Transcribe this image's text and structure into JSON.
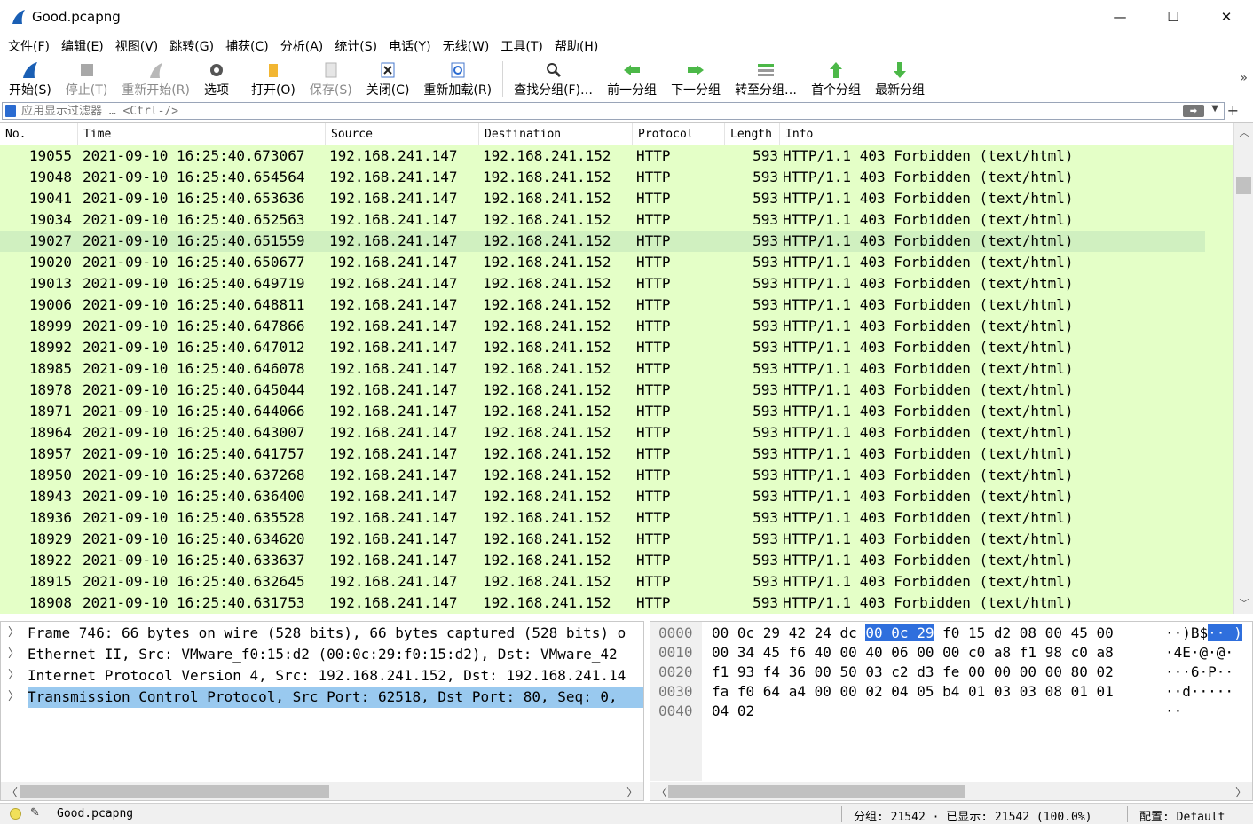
{
  "window": {
    "title": "Good.pcapng",
    "minimize_glyph": "—",
    "maximize_glyph": "☐",
    "close_glyph": "✕"
  },
  "menu": [
    "文件(F)",
    "编辑(E)",
    "视图(V)",
    "跳转(G)",
    "捕获(C)",
    "分析(A)",
    "统计(S)",
    "电话(Y)",
    "无线(W)",
    "工具(T)",
    "帮助(H)"
  ],
  "toolbar": {
    "start": "开始(S)",
    "stop": "停止(T)",
    "restart": "重新开始(R)",
    "options": "选项",
    "open": "打开(O)",
    "save": "保存(S)",
    "close": "关闭(C)",
    "reload": "重新加载(R)",
    "find": "查找分组(F)…",
    "prev": "前一分组",
    "next": "下一分组",
    "goto": "转至分组…",
    "first": "首个分组",
    "last": "最新分组",
    "more": "»"
  },
  "filter": {
    "placeholder": "应用显示过滤器 … <Ctrl-/>",
    "add": "+"
  },
  "packet_list": {
    "columns": [
      "No.",
      "Time",
      "Source",
      "Destination",
      "Protocol",
      "Length",
      "Info"
    ],
    "selected_row": 4,
    "rows": [
      {
        "no": "19055",
        "time": "2021-09-10 16:25:40.673067",
        "src": "192.168.241.147",
        "dst": "192.168.241.152",
        "proto": "HTTP",
        "len": "593",
        "info": "HTTP/1.1 403 Forbidden  (text/html)"
      },
      {
        "no": "19048",
        "time": "2021-09-10 16:25:40.654564",
        "src": "192.168.241.147",
        "dst": "192.168.241.152",
        "proto": "HTTP",
        "len": "593",
        "info": "HTTP/1.1 403 Forbidden  (text/html)"
      },
      {
        "no": "19041",
        "time": "2021-09-10 16:25:40.653636",
        "src": "192.168.241.147",
        "dst": "192.168.241.152",
        "proto": "HTTP",
        "len": "593",
        "info": "HTTP/1.1 403 Forbidden  (text/html)"
      },
      {
        "no": "19034",
        "time": "2021-09-10 16:25:40.652563",
        "src": "192.168.241.147",
        "dst": "192.168.241.152",
        "proto": "HTTP",
        "len": "593",
        "info": "HTTP/1.1 403 Forbidden  (text/html)"
      },
      {
        "no": "19027",
        "time": "2021-09-10 16:25:40.651559",
        "src": "192.168.241.147",
        "dst": "192.168.241.152",
        "proto": "HTTP",
        "len": "593",
        "info": "HTTP/1.1 403 Forbidden  (text/html)"
      },
      {
        "no": "19020",
        "time": "2021-09-10 16:25:40.650677",
        "src": "192.168.241.147",
        "dst": "192.168.241.152",
        "proto": "HTTP",
        "len": "593",
        "info": "HTTP/1.1 403 Forbidden  (text/html)"
      },
      {
        "no": "19013",
        "time": "2021-09-10 16:25:40.649719",
        "src": "192.168.241.147",
        "dst": "192.168.241.152",
        "proto": "HTTP",
        "len": "593",
        "info": "HTTP/1.1 403 Forbidden  (text/html)"
      },
      {
        "no": "19006",
        "time": "2021-09-10 16:25:40.648811",
        "src": "192.168.241.147",
        "dst": "192.168.241.152",
        "proto": "HTTP",
        "len": "593",
        "info": "HTTP/1.1 403 Forbidden  (text/html)"
      },
      {
        "no": "18999",
        "time": "2021-09-10 16:25:40.647866",
        "src": "192.168.241.147",
        "dst": "192.168.241.152",
        "proto": "HTTP",
        "len": "593",
        "info": "HTTP/1.1 403 Forbidden  (text/html)"
      },
      {
        "no": "18992",
        "time": "2021-09-10 16:25:40.647012",
        "src": "192.168.241.147",
        "dst": "192.168.241.152",
        "proto": "HTTP",
        "len": "593",
        "info": "HTTP/1.1 403 Forbidden  (text/html)"
      },
      {
        "no": "18985",
        "time": "2021-09-10 16:25:40.646078",
        "src": "192.168.241.147",
        "dst": "192.168.241.152",
        "proto": "HTTP",
        "len": "593",
        "info": "HTTP/1.1 403 Forbidden  (text/html)"
      },
      {
        "no": "18978",
        "time": "2021-09-10 16:25:40.645044",
        "src": "192.168.241.147",
        "dst": "192.168.241.152",
        "proto": "HTTP",
        "len": "593",
        "info": "HTTP/1.1 403 Forbidden  (text/html)"
      },
      {
        "no": "18971",
        "time": "2021-09-10 16:25:40.644066",
        "src": "192.168.241.147",
        "dst": "192.168.241.152",
        "proto": "HTTP",
        "len": "593",
        "info": "HTTP/1.1 403 Forbidden  (text/html)"
      },
      {
        "no": "18964",
        "time": "2021-09-10 16:25:40.643007",
        "src": "192.168.241.147",
        "dst": "192.168.241.152",
        "proto": "HTTP",
        "len": "593",
        "info": "HTTP/1.1 403 Forbidden  (text/html)"
      },
      {
        "no": "18957",
        "time": "2021-09-10 16:25:40.641757",
        "src": "192.168.241.147",
        "dst": "192.168.241.152",
        "proto": "HTTP",
        "len": "593",
        "info": "HTTP/1.1 403 Forbidden  (text/html)"
      },
      {
        "no": "18950",
        "time": "2021-09-10 16:25:40.637268",
        "src": "192.168.241.147",
        "dst": "192.168.241.152",
        "proto": "HTTP",
        "len": "593",
        "info": "HTTP/1.1 403 Forbidden  (text/html)"
      },
      {
        "no": "18943",
        "time": "2021-09-10 16:25:40.636400",
        "src": "192.168.241.147",
        "dst": "192.168.241.152",
        "proto": "HTTP",
        "len": "593",
        "info": "HTTP/1.1 403 Forbidden  (text/html)"
      },
      {
        "no": "18936",
        "time": "2021-09-10 16:25:40.635528",
        "src": "192.168.241.147",
        "dst": "192.168.241.152",
        "proto": "HTTP",
        "len": "593",
        "info": "HTTP/1.1 403 Forbidden  (text/html)"
      },
      {
        "no": "18929",
        "time": "2021-09-10 16:25:40.634620",
        "src": "192.168.241.147",
        "dst": "192.168.241.152",
        "proto": "HTTP",
        "len": "593",
        "info": "HTTP/1.1 403 Forbidden  (text/html)"
      },
      {
        "no": "18922",
        "time": "2021-09-10 16:25:40.633637",
        "src": "192.168.241.147",
        "dst": "192.168.241.152",
        "proto": "HTTP",
        "len": "593",
        "info": "HTTP/1.1 403 Forbidden  (text/html)"
      },
      {
        "no": "18915",
        "time": "2021-09-10 16:25:40.632645",
        "src": "192.168.241.147",
        "dst": "192.168.241.152",
        "proto": "HTTP",
        "len": "593",
        "info": "HTTP/1.1 403 Forbidden  (text/html)"
      },
      {
        "no": "18908",
        "time": "2021-09-10 16:25:40.631753",
        "src": "192.168.241.147",
        "dst": "192.168.241.152",
        "proto": "HTTP",
        "len": "593",
        "info": "HTTP/1.1 403 Forbidden  (text/html)"
      }
    ]
  },
  "details": {
    "selected_row": 3,
    "rows": [
      "Frame 746: 66 bytes on wire (528 bits), 66 bytes captured (528 bits) o",
      "Ethernet II, Src: VMware_f0:15:d2 (00:0c:29:f0:15:d2), Dst: VMware_42",
      "Internet Protocol Version 4, Src: 192.168.241.152, Dst: 192.168.241.14",
      "Transmission Control Protocol, Src Port: 62518, Dst Port: 80, Seq: 0,"
    ]
  },
  "bytes": {
    "rows": [
      {
        "off": "0000",
        "hex_pre": "00 0c 29 42 24 dc ",
        "hex_hl": "00 0c  29",
        "hex_post": " f0 15 d2 08 00 45 00",
        "asc_pre": "··)B$",
        "asc_hl": "·· )",
        "asc_post": ""
      },
      {
        "off": "0010",
        "hex_pre": "00 34 45 f6 40 00 40 06  00 00 c0 a8 f1 98 c0 a8",
        "hex_hl": "",
        "hex_post": "",
        "asc_pre": "·4E·@·@·",
        "asc_hl": "",
        "asc_post": ""
      },
      {
        "off": "0020",
        "hex_pre": "f1 93 f4 36 00 50 03 c2  d3 fe 00 00 00 00 80 02",
        "hex_hl": "",
        "hex_post": "",
        "asc_pre": "···6·P··",
        "asc_hl": "",
        "asc_post": ""
      },
      {
        "off": "0030",
        "hex_pre": "fa f0 64 a4 00 00 02 04  05 b4 01 03 03 08 01 01",
        "hex_hl": "",
        "hex_post": "",
        "asc_pre": "··d·····",
        "asc_hl": "",
        "asc_post": ""
      },
      {
        "off": "0040",
        "hex_pre": "04 02",
        "hex_hl": "",
        "hex_post": "",
        "asc_pre": "··",
        "asc_hl": "",
        "asc_post": ""
      }
    ]
  },
  "status": {
    "file": "Good.pcapng",
    "packets": "分组: 21542 · 已显示: 21542 (100.0%)",
    "profile": "配置: Default"
  },
  "colors": {
    "http_row": "#e4ffc7",
    "selected_row": "#d0f0c0",
    "detail_selected": "#99c9ef",
    "byte_highlight": "#2f6fdd"
  }
}
